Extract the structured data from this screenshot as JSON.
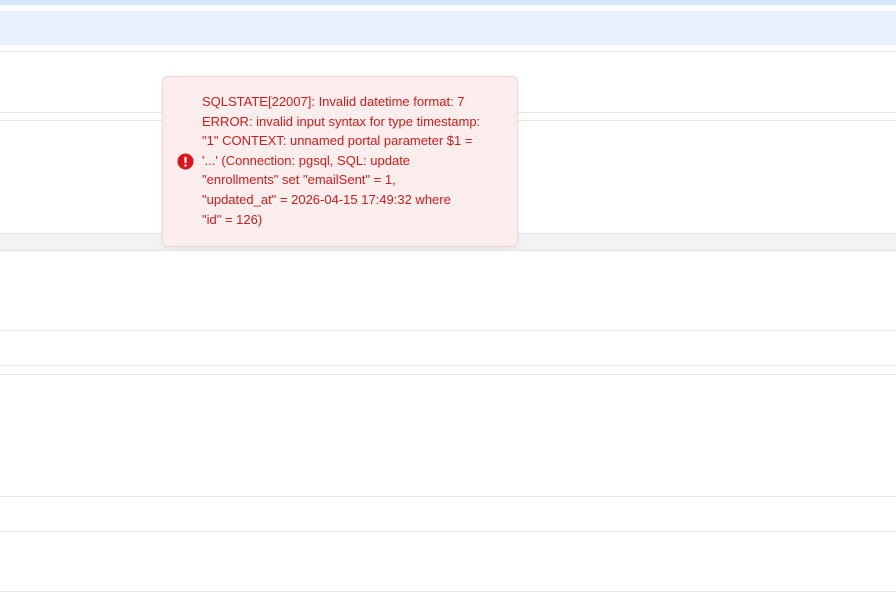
{
  "toast": {
    "type": "error",
    "icon": "exclamation-circle-icon",
    "message": "SQLSTATE[22007]: Invalid datetime format: 7\nERROR: invalid input syntax for type timestamp:\n\"1\" CONTEXT: unnamed portal parameter $1 =\n'...' (Connection: pgsql, SQL: update\n\"enrollments\" set \"emailSent\" = 1,\n\"updated_at\" = 2026-04-15 17:49:32 where\n\"id\" = 126)"
  },
  "colors": {
    "error_text": "#d41a1a",
    "error_background": "#fdeeee",
    "error_icon": "#e0131a",
    "header_band": "#e9f1fc",
    "top_accent": "#d5e6fb"
  }
}
